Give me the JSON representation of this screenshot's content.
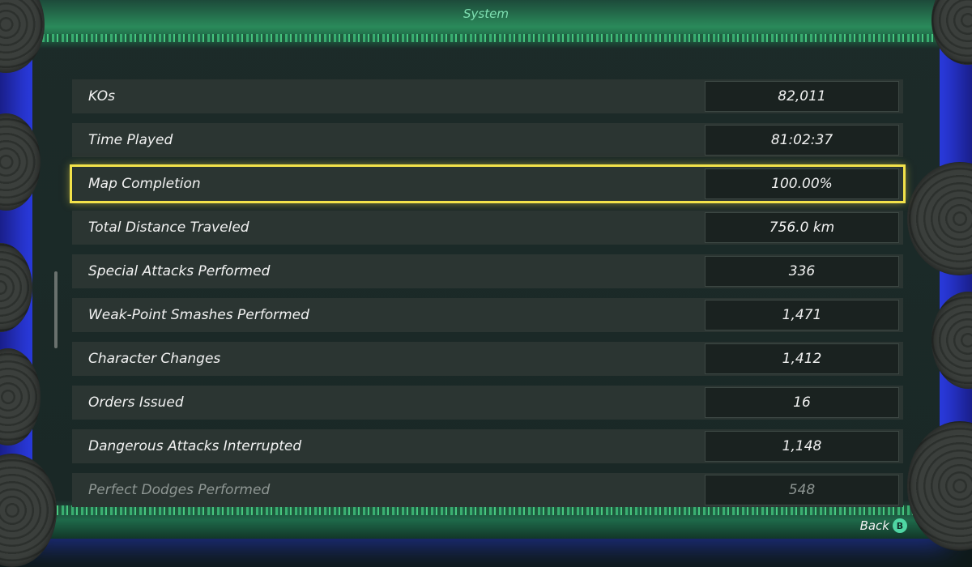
{
  "header": {
    "title": "System"
  },
  "stats": [
    {
      "label": "KOs",
      "value": "82,011"
    },
    {
      "label": "Time Played",
      "value": "81:02:37"
    },
    {
      "label": "Map Completion",
      "value": "100.00%"
    },
    {
      "label": "Total Distance Traveled",
      "value": "756.0 km"
    },
    {
      "label": "Special Attacks Performed",
      "value": "336"
    },
    {
      "label": "Weak-Point Smashes Performed",
      "value": "1,471"
    },
    {
      "label": "Character Changes",
      "value": "1,412"
    },
    {
      "label": "Orders Issued",
      "value": "16"
    },
    {
      "label": "Dangerous Attacks Interrupted",
      "value": "1,148"
    },
    {
      "label": "Perfect Dodges Performed",
      "value": "548"
    }
  ],
  "selected_index": 2,
  "footer": {
    "back_label": "Back",
    "back_button_glyph": "B"
  },
  "colors": {
    "highlight": "#f2e24a",
    "accent_green": "#4fd6a3",
    "side_glow": "#2a38d8"
  },
  "icons": {
    "back_button": "b-button-icon"
  }
}
